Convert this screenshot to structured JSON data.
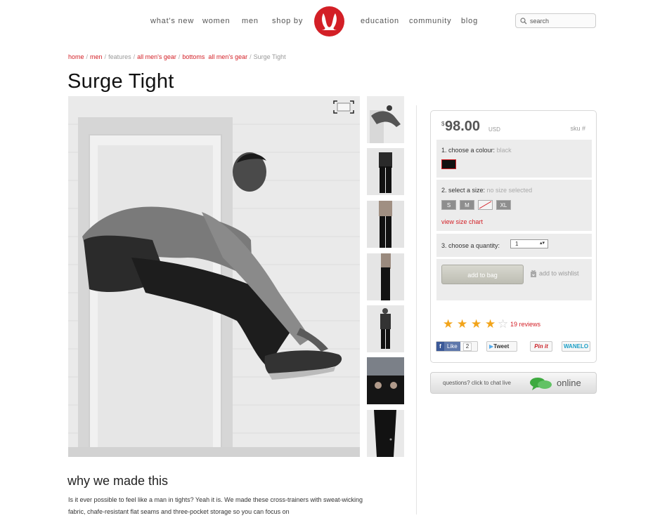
{
  "nav": {
    "left": [
      "what's new",
      "women",
      "men",
      "shop by"
    ],
    "right": [
      "education",
      "community",
      "blog"
    ],
    "search_placeholder": "search"
  },
  "breadcrumb": [
    {
      "text": "home",
      "link": true
    },
    {
      "text": "men",
      "link": true
    },
    {
      "text": "features",
      "link": false
    },
    {
      "text": "all men's gear",
      "link": true
    },
    {
      "text": "bottoms  all men's gear",
      "link": true
    },
    {
      "text": "Surge Tight",
      "link": false
    }
  ],
  "product": {
    "title": "Surge Tight",
    "price_symbol": "$",
    "price": "98.00",
    "currency": "USD",
    "sku_label": "sku #",
    "colour_label": "1. choose a colour:",
    "colour_value": "black",
    "size_label": "2. select a size:",
    "size_value": "no size selected",
    "sizes": [
      "S",
      "M",
      "",
      "XL"
    ],
    "size_chart": "view size chart",
    "qty_label": "3. choose a quantity:",
    "qty_value": "1",
    "add_to_bag": "add to bag",
    "wishlist": "add to wishlist",
    "rating": 4,
    "reviews": "19 reviews"
  },
  "share": {
    "like": "Like",
    "like_count": "2",
    "tweet": "Tweet",
    "pinit": "Pin it",
    "wanelo": "WANELO"
  },
  "chat": {
    "question": "questions? click to chat live",
    "status": "online"
  },
  "why": {
    "title": "why we made this",
    "text": "Is it ever possible to feel like a man in tights? Yeah it is. We made these cross-trainers with sweat-wicking fabric, chafe-resistant flat seams and three-pocket storage so you can focus on"
  },
  "colors": {
    "brand_red": "#d31f26",
    "star": "#f2a41a",
    "option_bg": "#ececec"
  }
}
